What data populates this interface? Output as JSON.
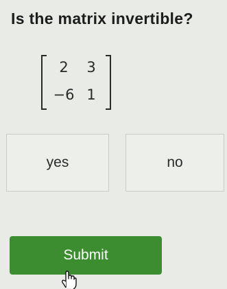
{
  "question": "Is the matrix invertible?",
  "matrix": [
    [
      "2",
      "3"
    ],
    [
      "−6",
      "1"
    ]
  ],
  "choices": {
    "yes": "yes",
    "no": "no"
  },
  "submit_label": "Submit",
  "colors": {
    "background": "#e9ece6",
    "submit": "#3c8d2f"
  },
  "icons": {
    "cursor": "hand-pointer-icon"
  }
}
